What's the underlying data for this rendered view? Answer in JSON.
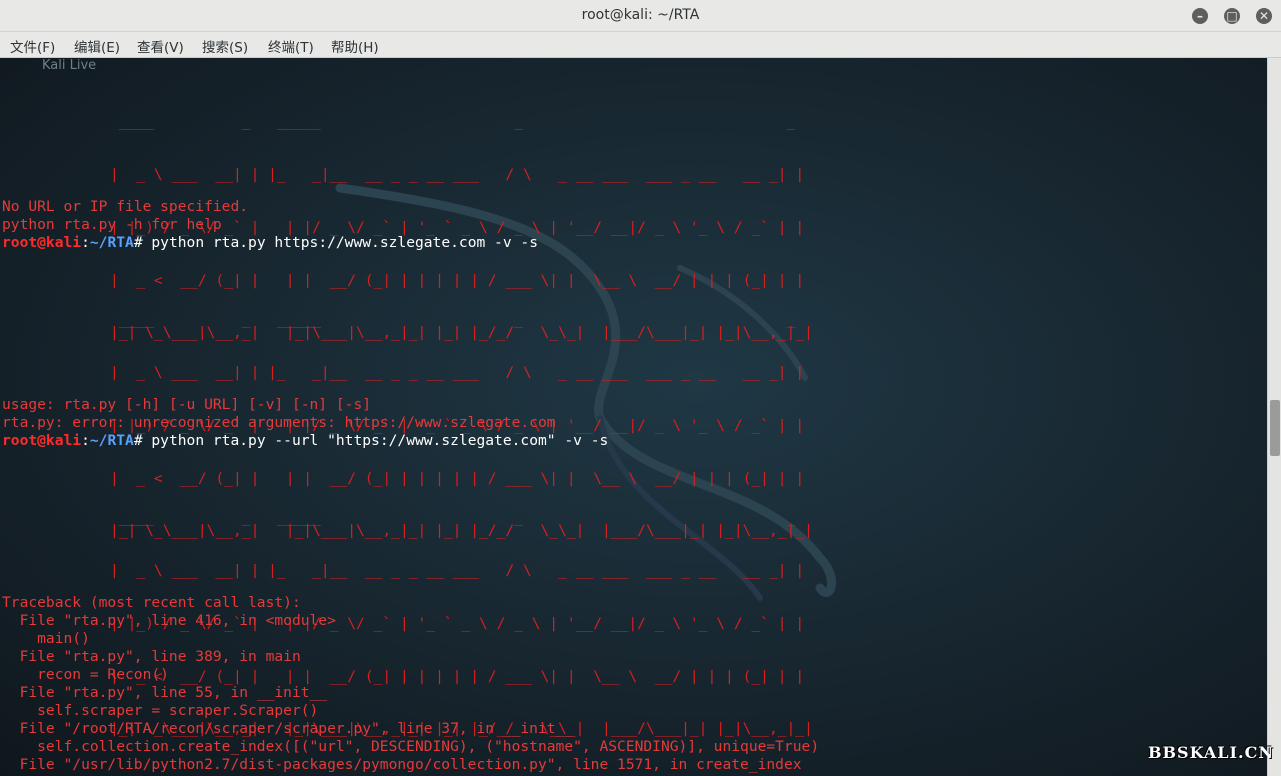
{
  "window": {
    "title": "root@kali: ~/RTA"
  },
  "menu": [
    "文件(F)",
    "编辑(E)",
    "查看(V)",
    "搜索(S)",
    "终端(T)",
    "帮助(H)"
  ],
  "desktop_label": "Kali Live",
  "banner": [
    " ____          _   _____                      _                              _ ",
    "|  _ \\ ___  __| | |_   _|__  __ _ _ __ ___   / \\   _ __ ___  ___ _ __   __ _| |",
    "| |_) / _ \\/ _` |   | |/ _ \\/ _` | '_ ` _ \\ / _ \\ | '__/ __|/ _ \\ '_ \\ / _` | |",
    "|  _ <  __/ (_| |   | |  __/ (_| | | | | | / ___ \\| |  \\__ \\  __/ | | | (_| | |",
    "|_| \\_\\___|\\__,_|   |_|\\___|\\__,_|_| |_| |_/_/   \\_\\_|  |___/\\___|_| |_|\\__,_|_|"
  ],
  "output1": [
    "No URL or IP file specified.",
    "python rta.py -h for help"
  ],
  "prompt": {
    "user": "root@kali",
    "sep": ":",
    "path_prefix": "~/",
    "path": "RTA",
    "hash": "# "
  },
  "cmd1": "python rta.py https://www.szlegate.com -v -s",
  "output2": [
    "usage: rta.py [-h] [-u URL] [-v] [-n] [-s]",
    "rta.py: error: unrecognized arguments: https://www.szlegate.com"
  ],
  "cmd2": "python rta.py --url \"https://www.szlegate.com\" -v -s",
  "traceback": [
    "Traceback (most recent call last):",
    "  File \"rta.py\", line 416, in <module>",
    "    main()",
    "  File \"rta.py\", line 389, in main",
    "    recon = Recon()",
    "  File \"rta.py\", line 55, in __init__",
    "    self.scraper = scraper.Scraper()",
    "  File \"/root/RTA/recon/scraper/scraper.py\", line 37, in __init__",
    "    self.collection.create_index([(\"url\", DESCENDING), (\"hostname\", ASCENDING)], unique=True)",
    "  File \"/usr/lib/python2.7/dist-packages/pymongo/collection.py\", line 1571, in create_index"
  ],
  "watermark": "BBSKALI.CN"
}
